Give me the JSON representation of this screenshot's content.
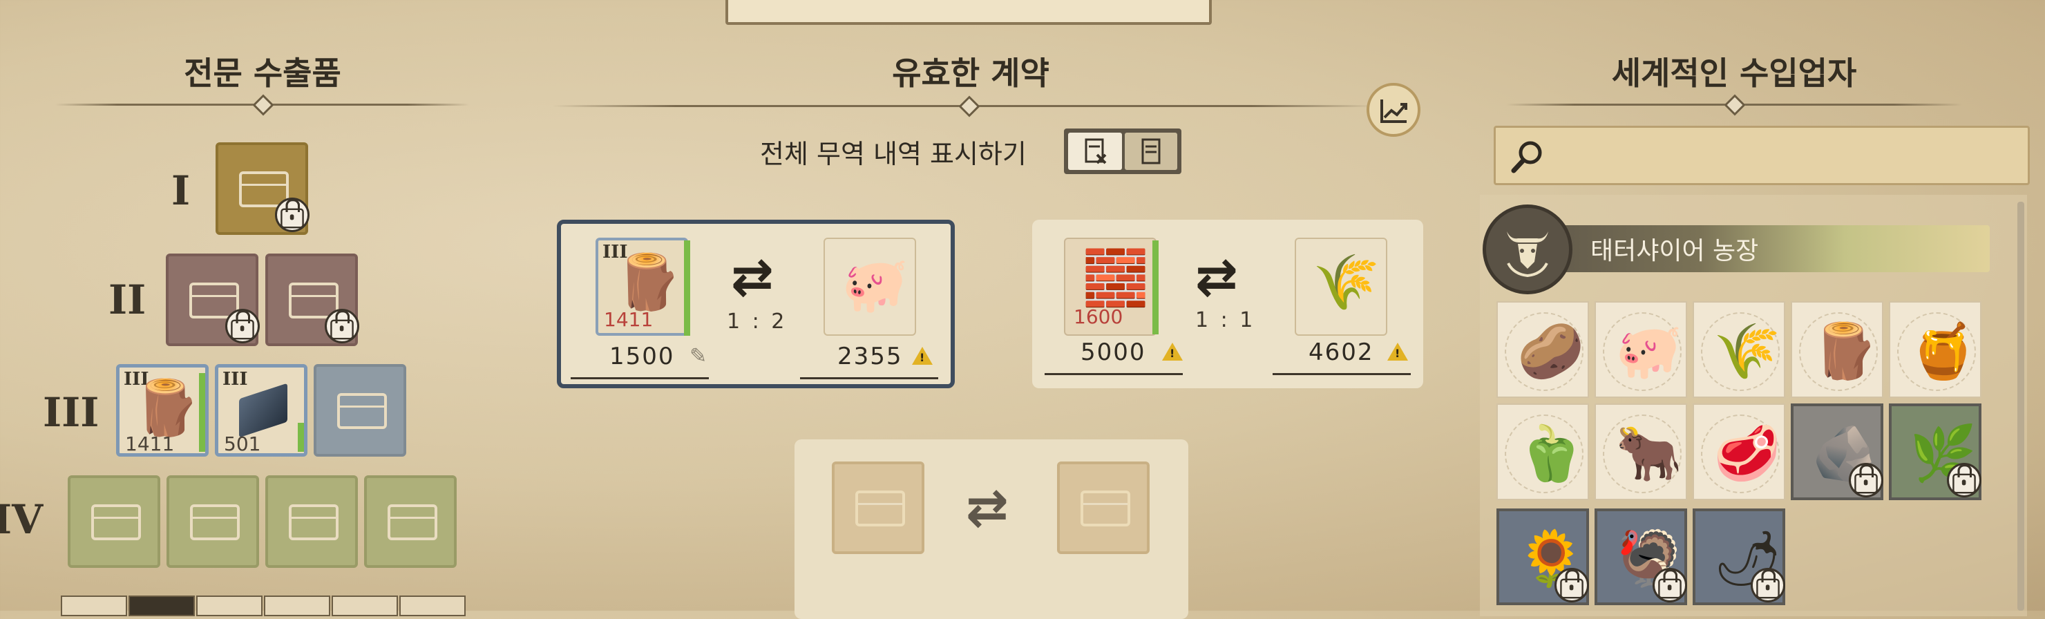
{
  "left": {
    "title": "전문 수출품",
    "tiers": [
      "I",
      "II",
      "III",
      "IV"
    ],
    "items": [
      {
        "tier": "III",
        "count": "1411",
        "icon": "wood-planks-icon"
      },
      {
        "tier": "III",
        "count": "501",
        "icon": "steel-beam-icon"
      }
    ]
  },
  "center": {
    "title": "유효한 계약",
    "toggle_label": "전체 무역 내역 표시하기",
    "contract1": {
      "tier": "III",
      "stock": "1411",
      "give": "1500",
      "ratio": "1 : 2",
      "get": "2355"
    },
    "contract2": {
      "stock": "1600",
      "give": "5000",
      "ratio": "1 : 1",
      "get": "4602"
    }
  },
  "right": {
    "title": "세계적인 수입업자",
    "search_placeholder": "",
    "importer_name": "태터샤이어 농장"
  },
  "colors": {
    "accent": "#7bbb47",
    "warning": "#e2b224",
    "selected_border": "#3f4d5e",
    "stock_red": "#b8413a"
  }
}
